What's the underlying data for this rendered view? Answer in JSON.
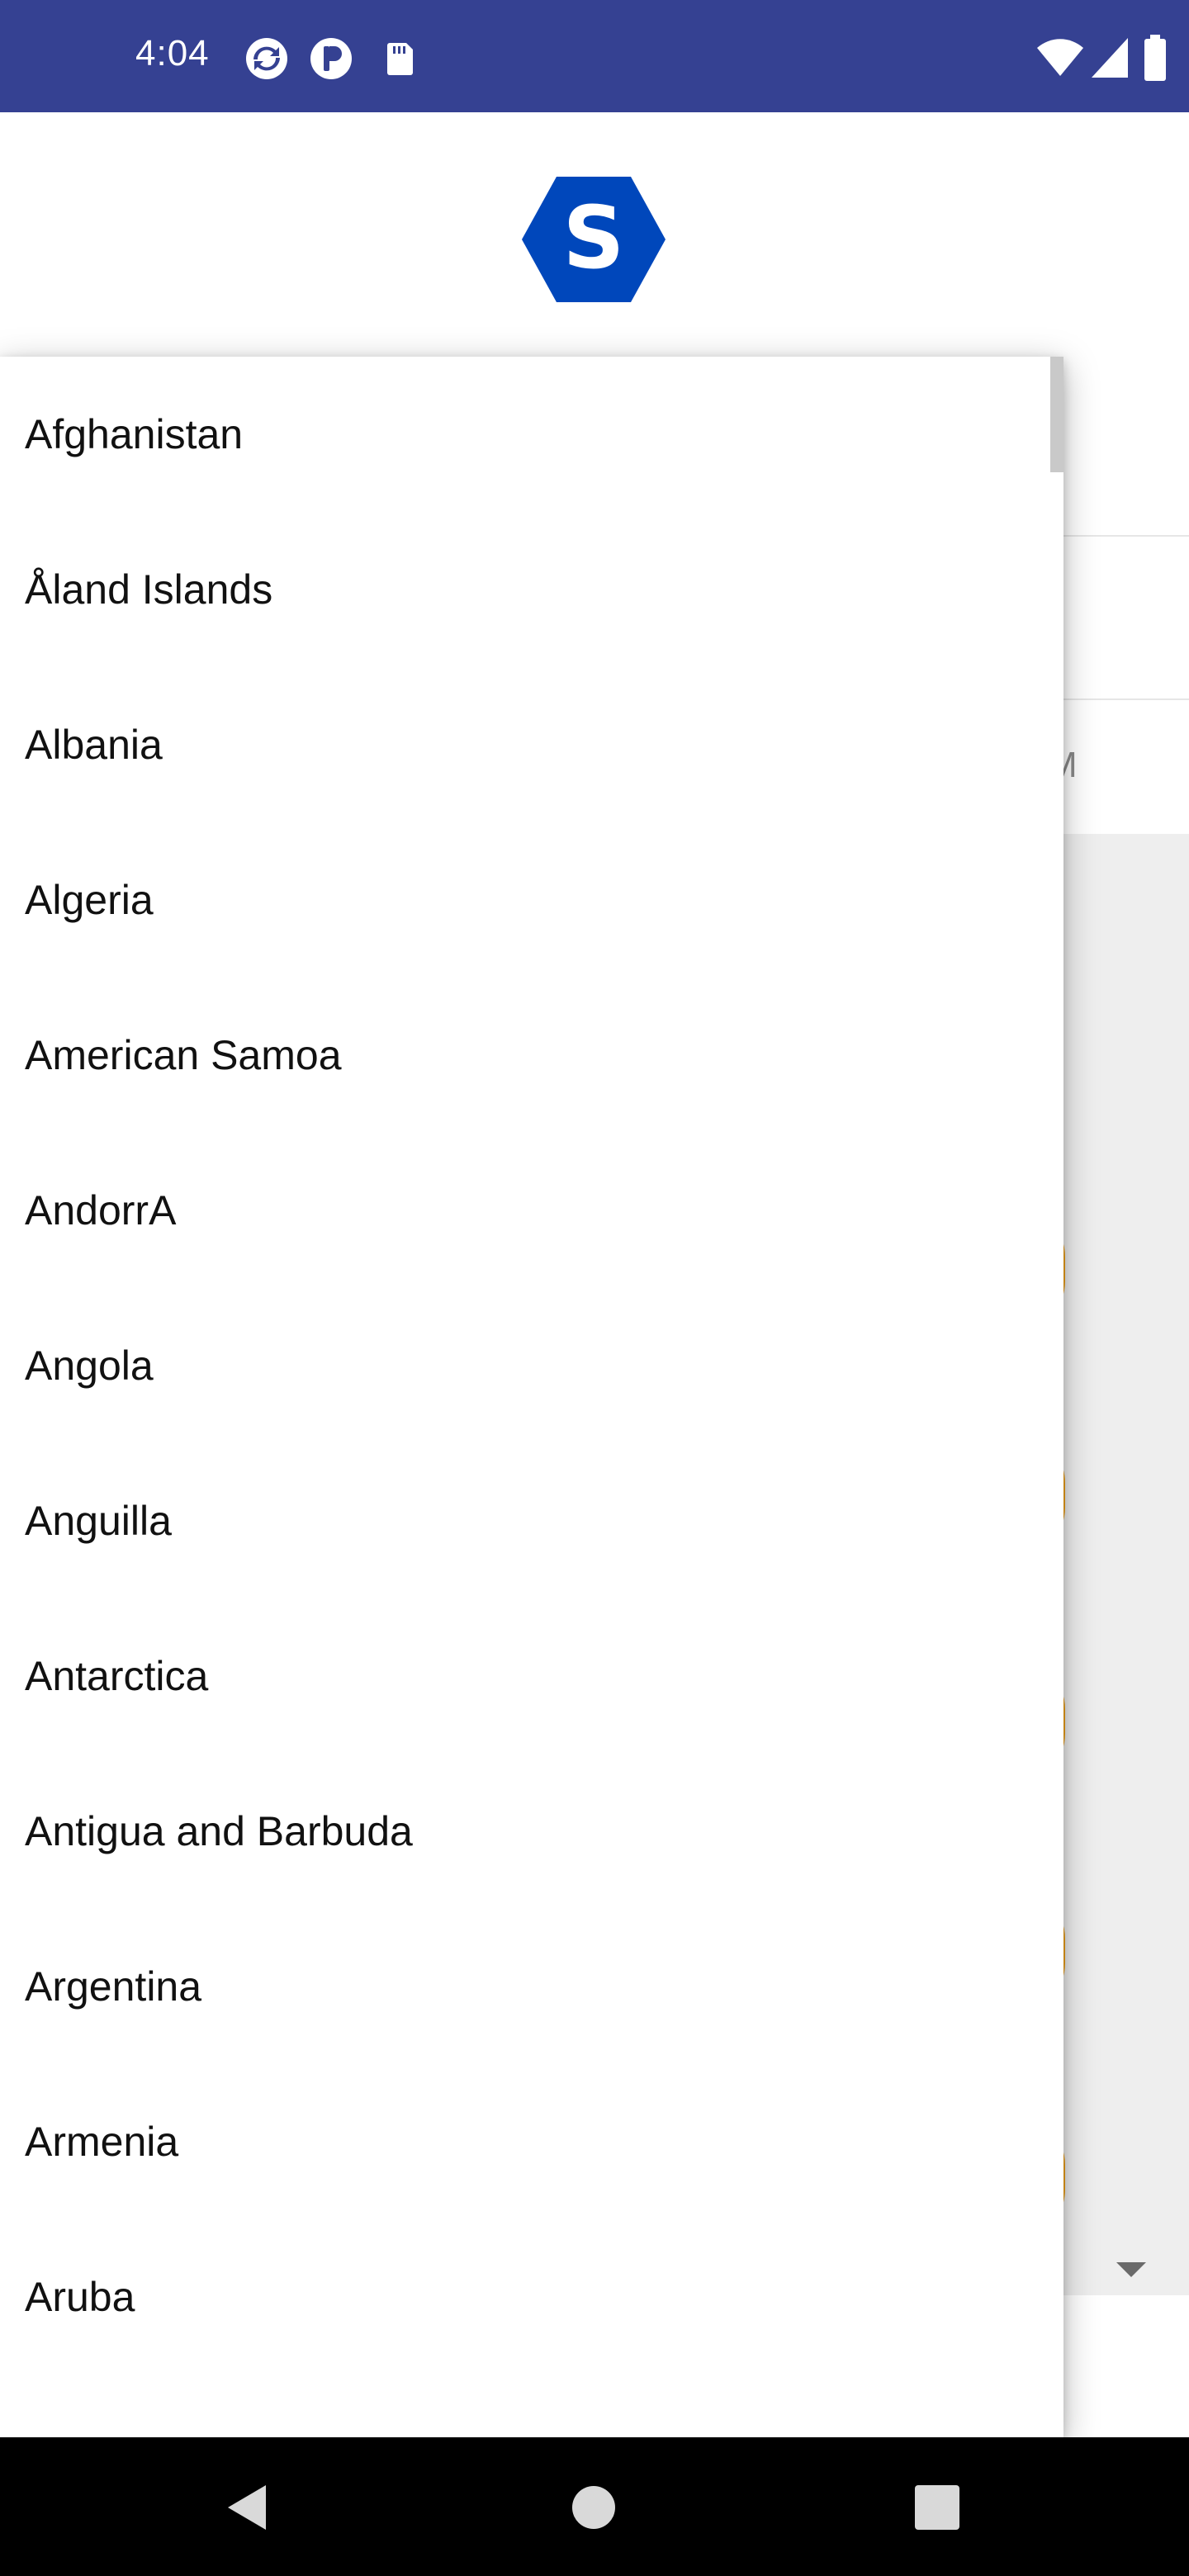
{
  "status_bar": {
    "time": "4:04",
    "left_icons": [
      "sync-icon",
      "app-p-icon",
      "sd-card-icon"
    ],
    "right_icons": [
      "wifi-icon",
      "signal-icon",
      "battery-icon"
    ],
    "background_color": "#354192"
  },
  "app": {
    "logo_letter": "S",
    "logo_color": "#0047BB",
    "accent_color": "#F2A31B",
    "background_letter": "M"
  },
  "dropdown": {
    "items": [
      "Afghanistan",
      "Åland Islands",
      "Albania",
      "Algeria",
      "American Samoa",
      "AndorrA",
      "Angola",
      "Anguilla",
      "Antarctica",
      "Antigua and Barbuda",
      "Argentina",
      "Armenia",
      "Aruba"
    ]
  },
  "nav_bar": {
    "buttons": [
      "back-icon",
      "home-icon",
      "recents-icon"
    ]
  }
}
